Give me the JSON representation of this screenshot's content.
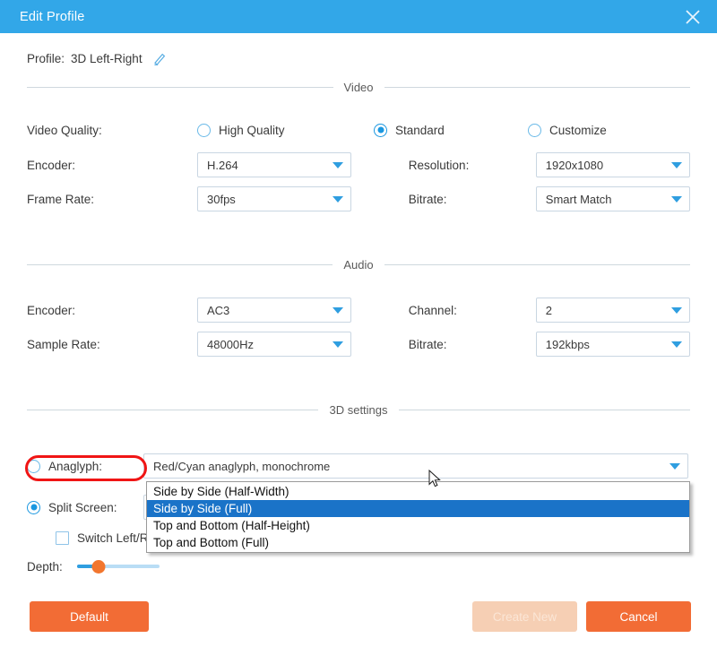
{
  "window": {
    "title": "Edit Profile",
    "close_icon": "close-icon",
    "accent_color": "#32a7e8"
  },
  "profile": {
    "label": "Profile:",
    "name": "3D Left-Right",
    "edit_icon": "pencil-icon"
  },
  "sections": {
    "video": "Video",
    "audio": "Audio",
    "three_d": "3D settings"
  },
  "video": {
    "quality_label": "Video Quality:",
    "quality_options": [
      {
        "label": "High Quality",
        "checked": false
      },
      {
        "label": "Standard",
        "checked": true
      },
      {
        "label": "Customize",
        "checked": false
      }
    ],
    "encoder_label": "Encoder:",
    "encoder_value": "H.264",
    "resolution_label": "Resolution:",
    "resolution_value": "1920x1080",
    "framerate_label": "Frame Rate:",
    "framerate_value": "30fps",
    "bitrate_label": "Bitrate:",
    "bitrate_value": "Smart Match"
  },
  "audio": {
    "encoder_label": "Encoder:",
    "encoder_value": "AC3",
    "channel_label": "Channel:",
    "channel_value": "2",
    "samplerate_label": "Sample Rate:",
    "samplerate_value": "48000Hz",
    "bitrate_label": "Bitrate:",
    "bitrate_value": "192kbps"
  },
  "three_d": {
    "anaglyph_label": "Anaglyph:",
    "anaglyph_checked": false,
    "anaglyph_value": "Red/Cyan anaglyph, monochrome",
    "split_label": "Split Screen:",
    "split_checked": true,
    "split_value": "Side by Side (Full)",
    "split_highlight_color": "#f01515",
    "switch_label": "Switch Left/Right",
    "switch_checked": false,
    "depth_label": "Depth:",
    "depth_percent": 26
  },
  "dropdown": {
    "open": true,
    "selected": "Side by Side (Full)",
    "items": [
      "Side by Side (Half-Width)",
      "Side by Side (Full)",
      "Top and Bottom (Half-Height)",
      "Top and Bottom (Full)"
    ]
  },
  "footer": {
    "default_label": "Default",
    "create_label": "Create New",
    "cancel_label": "Cancel",
    "button_color": "#f26c35",
    "create_disabled_color": "#f6cfb4"
  }
}
